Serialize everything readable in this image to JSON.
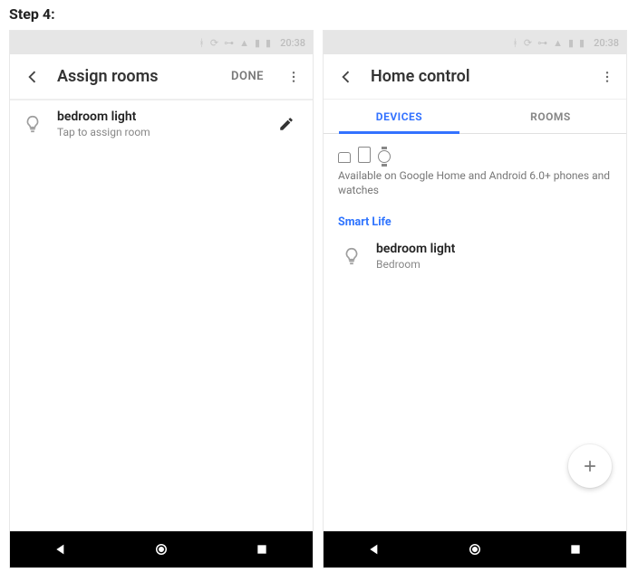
{
  "page_label": "Step 4:",
  "status": {
    "time": "20:38"
  },
  "left": {
    "title": "Assign rooms",
    "done_label": "DONE",
    "device": {
      "name": "bedroom light",
      "sub": "Tap to assign room"
    }
  },
  "right": {
    "title": "Home control",
    "tabs": {
      "devices": "DEVICES",
      "rooms": "ROOMS",
      "active": "devices"
    },
    "availability": "Available on Google Home and Android 6.0+ phones and watches",
    "service": "Smart Life",
    "device": {
      "name": "bedroom light",
      "room": "Bedroom"
    }
  }
}
